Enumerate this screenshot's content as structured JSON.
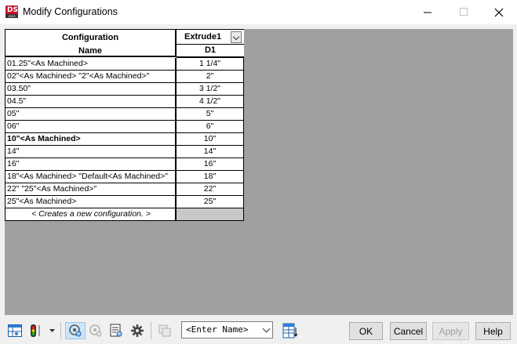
{
  "window": {
    "title": "Modify Configurations",
    "app_icon": "solidworks-icon"
  },
  "table": {
    "name_header_line1": "Configuration",
    "name_header_line2": "Name",
    "feature_header": "Extrude1",
    "dimension_header": "D1",
    "rows": [
      {
        "name": "01.25\"<As Machined>",
        "value": "1 1/4\""
      },
      {
        "name": "02\"<As Machined> \"2\"<As Machined>\"",
        "value": "2\""
      },
      {
        "name": "03.50\"",
        "value": "3 1/2\""
      },
      {
        "name": "04.5\"",
        "value": "4 1/2\""
      },
      {
        "name": "05\"",
        "value": "5\""
      },
      {
        "name": "06\"",
        "value": "6\""
      },
      {
        "name": "10\"<As Machined>",
        "value": "10\"",
        "active": true
      },
      {
        "name": "14\"",
        "value": "14\""
      },
      {
        "name": "16\"",
        "value": "16\""
      },
      {
        "name": "18\"<As Machined> \"Default<As Machined>\"",
        "value": "18\""
      },
      {
        "name": "22\" \"25\"<As Machined>\"",
        "value": "22\""
      },
      {
        "name": "25\"<As Machined>",
        "value": "25\""
      }
    ],
    "new_config_label": "< Creates a new configuration. >"
  },
  "toolbar": {
    "name_combo_value": "<Enter Name>",
    "ok_label": "OK",
    "cancel_label": "Cancel",
    "apply_label": "Apply",
    "help_label": "Help"
  }
}
